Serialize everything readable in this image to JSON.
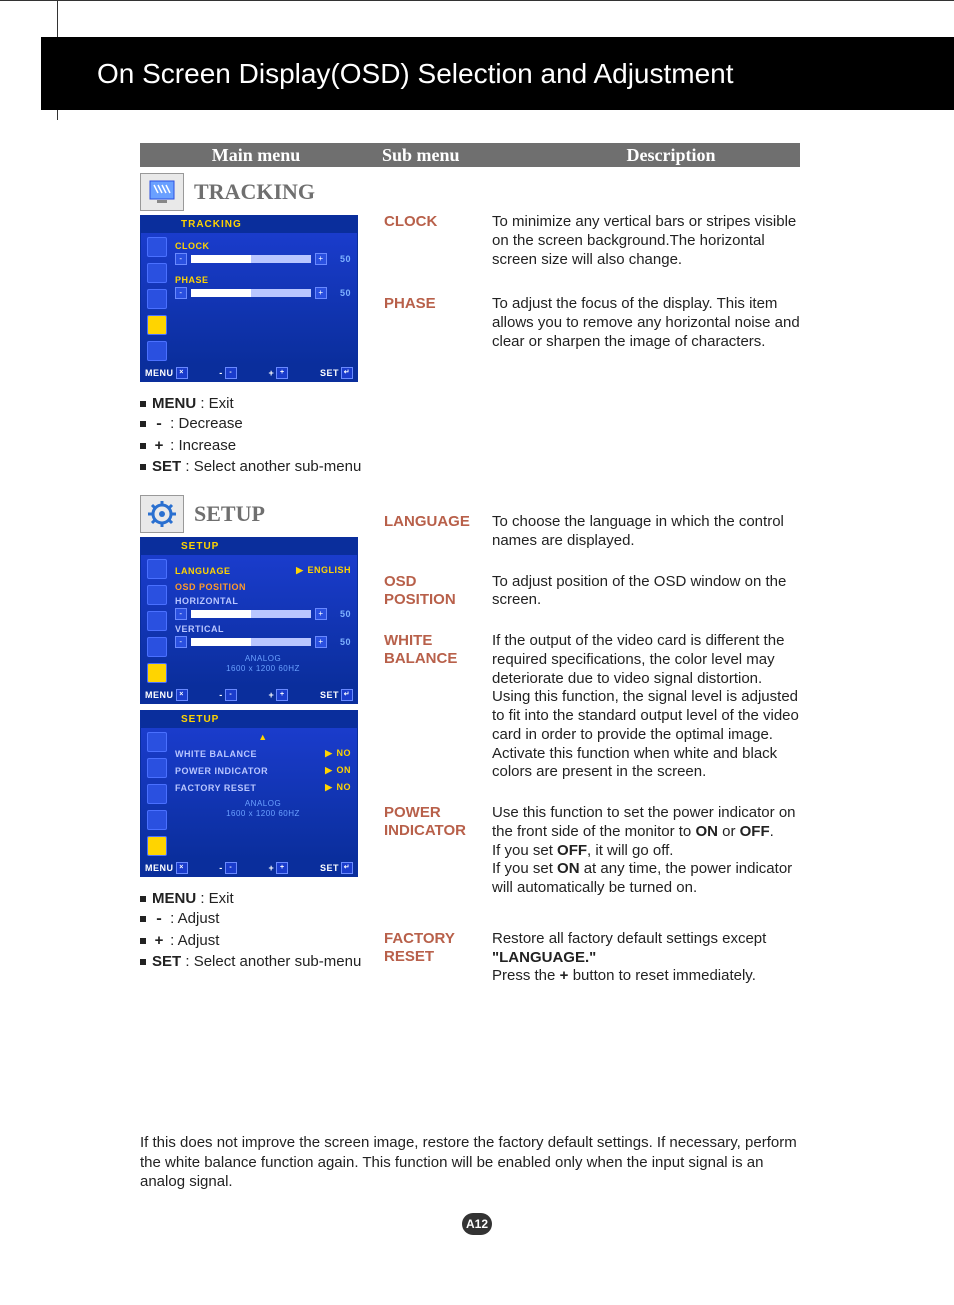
{
  "page_title": "On Screen Display(OSD) Selection and Adjustment",
  "columns": {
    "main": "Main menu",
    "sub": "Sub menu",
    "desc": "Description"
  },
  "tracking": {
    "title": "TRACKING",
    "osd": {
      "title": "TRACKING",
      "clock_label": "CLOCK",
      "phase_label": "PHASE",
      "clock_value": "50",
      "phase_value": "50",
      "footer_menu": "MENU",
      "footer_set": "SET",
      "footer_minus": "-",
      "footer_plus": "+"
    },
    "legend": {
      "menu_label": "MENU",
      "menu_text": " : Exit",
      "minus_label": "-",
      "minus_text": " : Decrease",
      "plus_label": "+",
      "plus_text": " : Increase",
      "set_label": "SET",
      "set_text": " : Select another sub-menu"
    },
    "items": {
      "clock": {
        "sub": "CLOCK",
        "desc": "To minimize any vertical bars or stripes visible on the screen background.The horizontal screen size will also change."
      },
      "phase": {
        "sub": "PHASE",
        "desc": "To adjust the focus of the display. This item allows you to remove any horizontal noise and clear or sharpen the image of characters."
      }
    }
  },
  "setup": {
    "title": "SETUP",
    "osd1": {
      "title": "SETUP",
      "language_label": "LANGUAGE",
      "language_value": "ENGLISH",
      "osd_position_label": "OSD POSITION",
      "horizontal_label": "HORIZONTAL",
      "horizontal_value": "50",
      "vertical_label": "VERTICAL",
      "vertical_value": "50",
      "info_line1": "ANALOG",
      "info_line2": "1600 x 1200 60HZ",
      "footer_menu": "MENU",
      "footer_set": "SET",
      "footer_minus": "-",
      "footer_plus": "+"
    },
    "osd2": {
      "title": "SETUP",
      "white_balance_label": "WHITE BALANCE",
      "white_balance_value": "NO",
      "power_indicator_label": "POWER INDICATOR",
      "power_indicator_value": "ON",
      "factory_reset_label": "FACTORY RESET",
      "factory_reset_value": "NO",
      "info_line1": "ANALOG",
      "info_line2": "1600 x 1200 60HZ",
      "footer_menu": "MENU",
      "footer_set": "SET",
      "footer_minus": "-",
      "footer_plus": "+"
    },
    "legend": {
      "menu_label": "MENU",
      "menu_text": " : Exit",
      "minus_label": "-",
      "minus_text": " : Adjust",
      "plus_label": "+",
      "plus_text": " : Adjust",
      "set_label": "SET",
      "set_text": " : Select another sub-menu"
    },
    "items": {
      "language": {
        "sub": "LANGUAGE",
        "desc": "To choose the language in which the control names are displayed."
      },
      "osd_position": {
        "sub": "OSD POSITION",
        "desc": "To adjust position of the OSD window on the screen."
      },
      "white_balance": {
        "sub": "WHITE BALANCE",
        "desc": "If the output of the video card is different the required specifications, the color level may deteriorate due to video signal distortion. Using this function, the signal level is adjusted to fit into the standard output level of the video card in order to provide the optimal image. Activate this function when white and black colors are present in the screen."
      },
      "power_indicator": {
        "sub": "POWER INDICATOR",
        "desc_1": "Use this function to set the power indicator on the front side of the monitor to ",
        "on": "ON",
        "desc_2": " or ",
        "off": "OFF",
        "desc_3": ".",
        "desc_4": "If you set ",
        "off2": "OFF",
        "desc_5": ", it will go off.",
        "desc_6": "If you set ",
        "on2": "ON",
        "desc_7": " at any time, the power indicator will automatically be turned on."
      },
      "factory_reset": {
        "sub": "FACTORY RESET",
        "desc_1": "Restore all factory default settings except ",
        "lang": "\"LANGUAGE.\"",
        "desc_2": "Press the ",
        "plus": "+",
        "desc_3": " button to reset immediately."
      }
    }
  },
  "footnote": "If this does not improve the screen image, restore the factory default settings. If necessary, perform the white balance function again. This function will be enabled only when the input signal is an analog signal.",
  "page_number": "A12"
}
